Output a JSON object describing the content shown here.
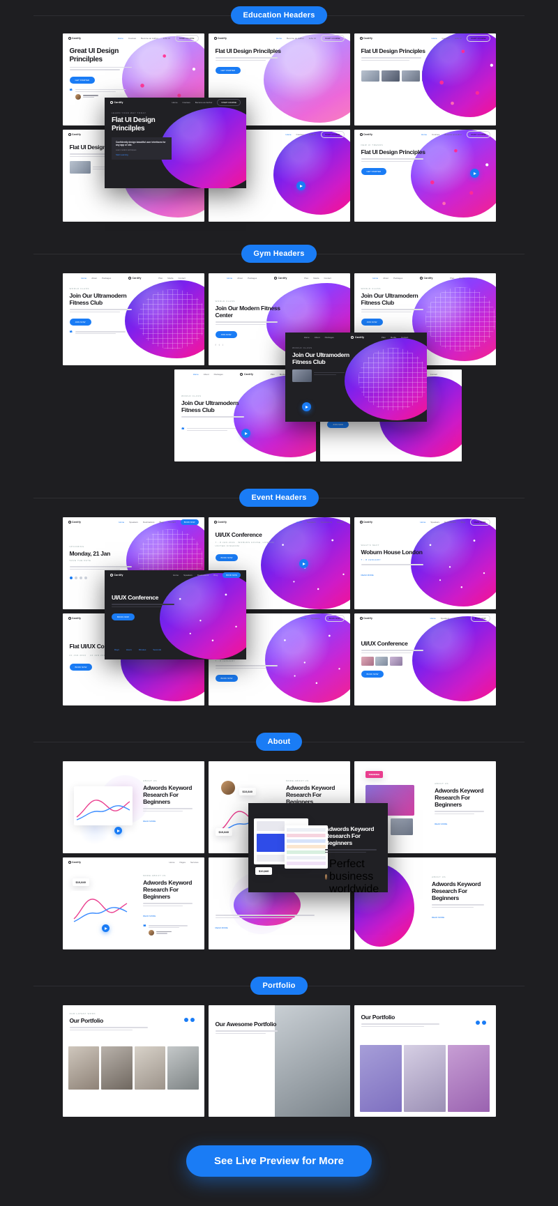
{
  "page": {
    "background": "#1e1e21",
    "accent": "#1a7cf5",
    "brand": "Cardify"
  },
  "sections": [
    {
      "badge": "Education Headers",
      "cards": [
        {
          "title": "Great UI Design Princilples",
          "kicker": "",
          "cta": "GET STARTED"
        },
        {
          "title": "Flat UI Design Princilples",
          "kicker": "",
          "cta": "GET STARTED"
        },
        {
          "title": "Flat UI Design Principles",
          "kicker": "",
          "cta": "GET STARTED"
        },
        {
          "title": "Flat UI Design Principles",
          "kicker": "",
          "cta": "GET STARTED"
        },
        {
          "title": "",
          "kicker": "",
          "cta": "GET STARTED"
        },
        {
          "title": "Flat UI Design Principles",
          "kicker": "NEW UI TRENDS",
          "cta": "GET STARTED"
        }
      ],
      "overlay": {
        "kicker": "LEARN YOUR WAY TODAY",
        "title": "Flat UI Design Princilples",
        "panel_title": "Confidently design beautiful user interfaces for any app or site.",
        "panel_sub": "Learn modern techniques",
        "panel_link": "Start Learning"
      }
    },
    {
      "badge": "Gym Headers",
      "cards": [
        {
          "title": "Join Our Ultramodern Fitness Club",
          "kicker": "WORLD CLASS",
          "cta": "JOIN NOW"
        },
        {
          "title": "Join Our Modern Fitness Center",
          "kicker": "WORLD CLASS",
          "cta": "JOIN NOW"
        },
        {
          "title": "Join Our Ultramodern Fitness Club",
          "kicker": "WORLD CLASS",
          "cta": "JOIN NOW"
        },
        {
          "title": "Join Our Ultramodern Fitness Club",
          "kicker": "WORLD CLASS",
          "cta": "JOIN NOW"
        },
        {
          "title": "Join Our Ultramodern Fitness Club",
          "kicker": "WORLD CLASS",
          "cta": "JOIN NOW"
        }
      ],
      "overlay": {
        "kicker": "WORLD CLASS",
        "title": "Join Our Ultramodern Fitness Club",
        "cta": "JOIN NOW"
      }
    },
    {
      "badge": "Event Headers",
      "cards": [
        {
          "title": "Monday, 21 Jan",
          "kicker": "UPCOMING",
          "sub": "SAVE THE DATE",
          "cta": "BOOK NOW"
        },
        {
          "title": "UI/UX Conference",
          "kicker": "",
          "sub": "7 - 8 JAN 2019 · WOBURN HOUSE, LONDON UNITED KINGDOM",
          "cta": "BOOK NOW"
        },
        {
          "title": "Woburn House London",
          "kicker": "WHAT'S NEXT",
          "sub": "7 - 8 January",
          "cta": "READ MORE"
        },
        {
          "title": "Flat UI/UX Conference",
          "kicker": "",
          "sub": "",
          "cta": "BOOK NOW"
        },
        {
          "title": "",
          "kicker": "",
          "sub": "7 - 8 January",
          "cta": "BOOK NOW"
        },
        {
          "title": "UI/UX Conference",
          "kicker": "",
          "sub": "",
          "cta": "BOOK NOW"
        }
      ],
      "overlay": {
        "kicker": "",
        "title": "UI/UX Conference",
        "cta": "BOOK NOW"
      }
    },
    {
      "badge": "About",
      "cards": [
        {
          "title": "Adwords Keyword Research For Beginners",
          "kicker": "ABOUT US",
          "cta": "READ MORE"
        },
        {
          "title": "Adwords Keyword Research For Beginners",
          "kicker": "MORE ABOUT US",
          "cta": "READ MORE"
        },
        {
          "title": "Adwords Keyword Research For Beginners",
          "kicker": "ABOUT US",
          "cta": "READ MORE"
        },
        {
          "title": "Adwords Keyword Research For Beginners",
          "kicker": "MORE ABOUT US",
          "cta": "READ MORE"
        },
        {
          "title": "",
          "kicker": "",
          "cta": "READ MORE"
        },
        {
          "title": "Adwords Keyword Research For Beginners",
          "kicker": "ABOUT US",
          "cta": "READ MORE"
        }
      ],
      "overlay": {
        "kicker": "",
        "title": "Adwords Keyword Research For Beginners",
        "panel_link": "Perfect business worldwide"
      }
    },
    {
      "badge": "Portfolio",
      "cards": [
        {
          "title": "Our Portfolio",
          "kicker": "OUR LATEST WORK",
          "cta": ""
        },
        {
          "title": "Our Awesome Portfolio",
          "kicker": "",
          "cta": ""
        },
        {
          "title": "Our Portfolio",
          "kicker": "",
          "cta": ""
        }
      ]
    }
  ],
  "cta": {
    "label": "See Live Preview for More"
  },
  "mini_nav": {
    "links": [
      "Home",
      "Courses",
      "Become an Author",
      "Jobs UI",
      "Start Course"
    ],
    "links_gym": [
      "Home",
      "About",
      "Packages",
      "Plan",
      "Media",
      "Contact"
    ],
    "links_event": [
      "Home",
      "Speakers",
      "Destinations",
      "Blog",
      "Contact"
    ],
    "links_about": [
      "Home",
      "Pages",
      "Services",
      "Blog",
      "Contact"
    ],
    "cta_label": "START COURSE"
  },
  "stats": {
    "value_a": "$10,840",
    "value_b": "$10,840",
    "value_c": "$10,840"
  }
}
